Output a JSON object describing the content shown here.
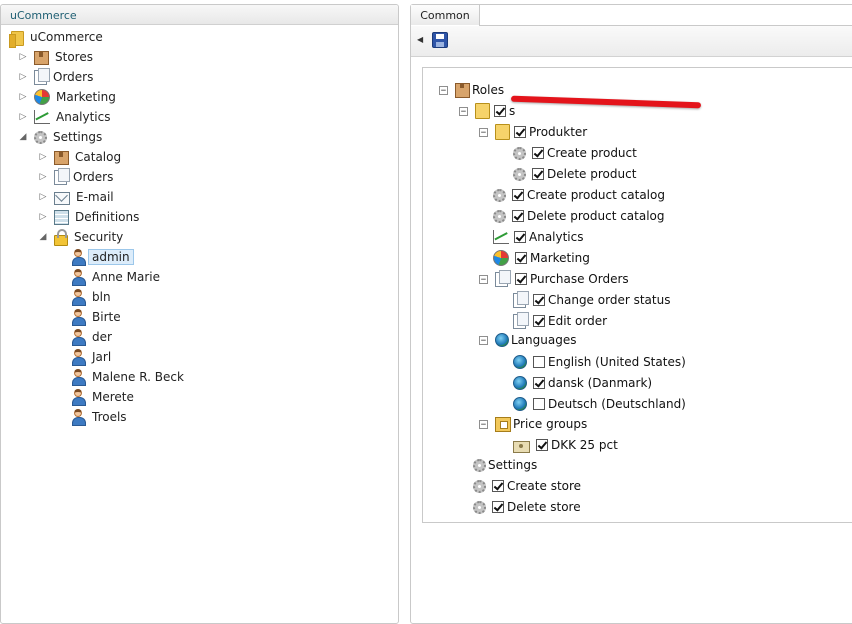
{
  "left": {
    "header": "uCommerce",
    "tree": [
      {
        "label": "uCommerce",
        "icon": "folder-icon"
      },
      {
        "label": "Stores",
        "icon": "box-icon"
      },
      {
        "label": "Orders",
        "icon": "pages-icon"
      },
      {
        "label": "Marketing",
        "icon": "pie-chart-icon"
      },
      {
        "label": "Analytics",
        "icon": "trend-chart-icon"
      },
      {
        "label": "Settings",
        "icon": "gear-icon"
      },
      {
        "label": "Catalog",
        "icon": "box-icon"
      },
      {
        "label": "Orders",
        "icon": "pages-icon"
      },
      {
        "label": "E-mail",
        "icon": "mail-icon"
      },
      {
        "label": "Definitions",
        "icon": "definitions-icon"
      },
      {
        "label": "Security",
        "icon": "lock-icon"
      },
      {
        "label": "admin",
        "icon": "user-icon",
        "selected": true
      },
      {
        "label": "Anne Marie",
        "icon": "user-icon"
      },
      {
        "label": "bln",
        "icon": "user-icon"
      },
      {
        "label": "Birte",
        "icon": "user-icon"
      },
      {
        "label": "der",
        "icon": "user-icon"
      },
      {
        "label": "Jarl",
        "icon": "user-icon"
      },
      {
        "label": "Malene R. Beck",
        "icon": "user-icon"
      },
      {
        "label": "Merete",
        "icon": "user-icon"
      },
      {
        "label": "Troels",
        "icon": "user-icon"
      }
    ]
  },
  "right": {
    "tab": "Common",
    "toolbar": {
      "save_icon": "save-icon",
      "collapse_icon": "arrow-left-icon"
    },
    "roles": {
      "root": "Roles",
      "store_label": "s",
      "items": [
        {
          "label": "Produkter",
          "checked": true
        },
        {
          "label": "Create product",
          "checked": true
        },
        {
          "label": "Delete product",
          "checked": true
        },
        {
          "label": "Create product catalog",
          "checked": true
        },
        {
          "label": "Delete product catalog",
          "checked": true
        },
        {
          "label": "Analytics",
          "checked": true
        },
        {
          "label": "Marketing",
          "checked": true
        },
        {
          "label": "Purchase Orders",
          "checked": true
        },
        {
          "label": "Change order status",
          "checked": true
        },
        {
          "label": "Edit order",
          "checked": true
        },
        {
          "label": "Languages"
        },
        {
          "label": "English (United States)",
          "checked": false
        },
        {
          "label": "dansk (Danmark)",
          "checked": true
        },
        {
          "label": "Deutsch (Deutschland)",
          "checked": false
        },
        {
          "label": "Price groups"
        },
        {
          "label": "DKK 25 pct",
          "checked": true
        },
        {
          "label": "Settings"
        },
        {
          "label": "Create store",
          "checked": true
        },
        {
          "label": "Delete store",
          "checked": true
        }
      ]
    },
    "redaction_color": "#e4141b"
  }
}
